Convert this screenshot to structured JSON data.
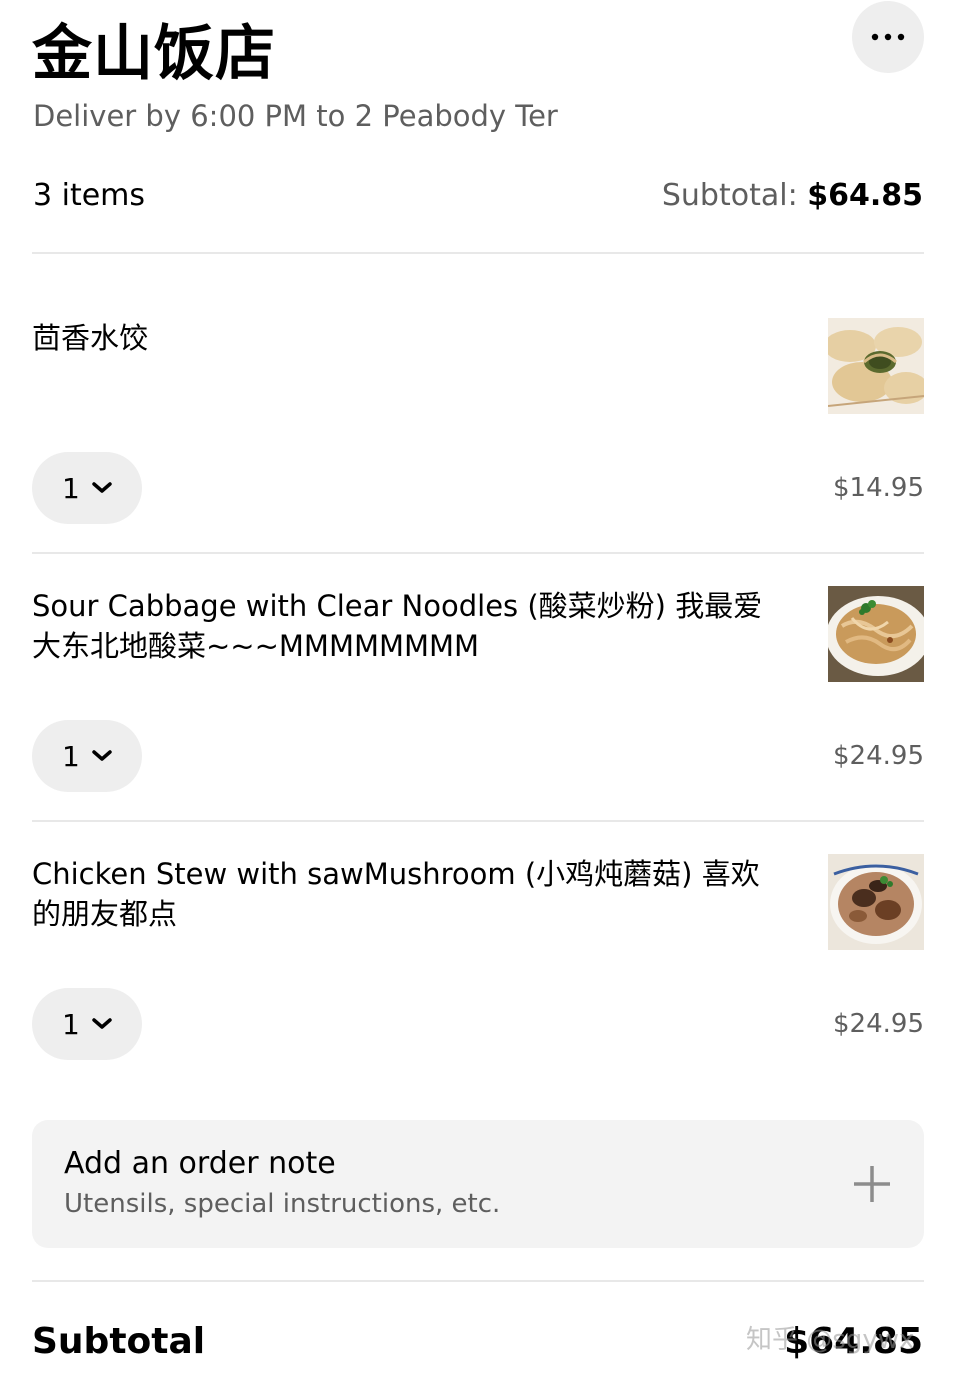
{
  "header": {
    "title": "金山饭店",
    "subtitle": "Deliver by 6:00 PM to 2 Peabody Ter",
    "more_icon": "more-horizontal-icon"
  },
  "summary": {
    "item_count": "3 items",
    "subtotal_label": "Subtotal: ",
    "subtotal_value": "$64.85"
  },
  "items": [
    {
      "name": "茴香水饺",
      "qty": "1",
      "price": "$14.95",
      "image": "dumplings"
    },
    {
      "name": "Sour Cabbage with Clear Noodles (酸菜炒粉) 我最爱大东北地酸菜~~~MMMMMMMM",
      "qty": "1",
      "price": "$24.95",
      "image": "sour-cabbage-noodles"
    },
    {
      "name": "Chicken Stew with sawMushroom (小鸡炖蘑菇) 喜欢的朋友都点",
      "qty": "1",
      "price": "$24.95",
      "image": "chicken-mushroom-stew"
    }
  ],
  "order_note": {
    "title": "Add an order note",
    "hint": "Utensils, special instructions, etc.",
    "icon": "plus-icon"
  },
  "footer": {
    "subtotal_label": "Subtotal",
    "subtotal_value": "$64.85",
    "watermark": "知乎 @sgywx"
  }
}
